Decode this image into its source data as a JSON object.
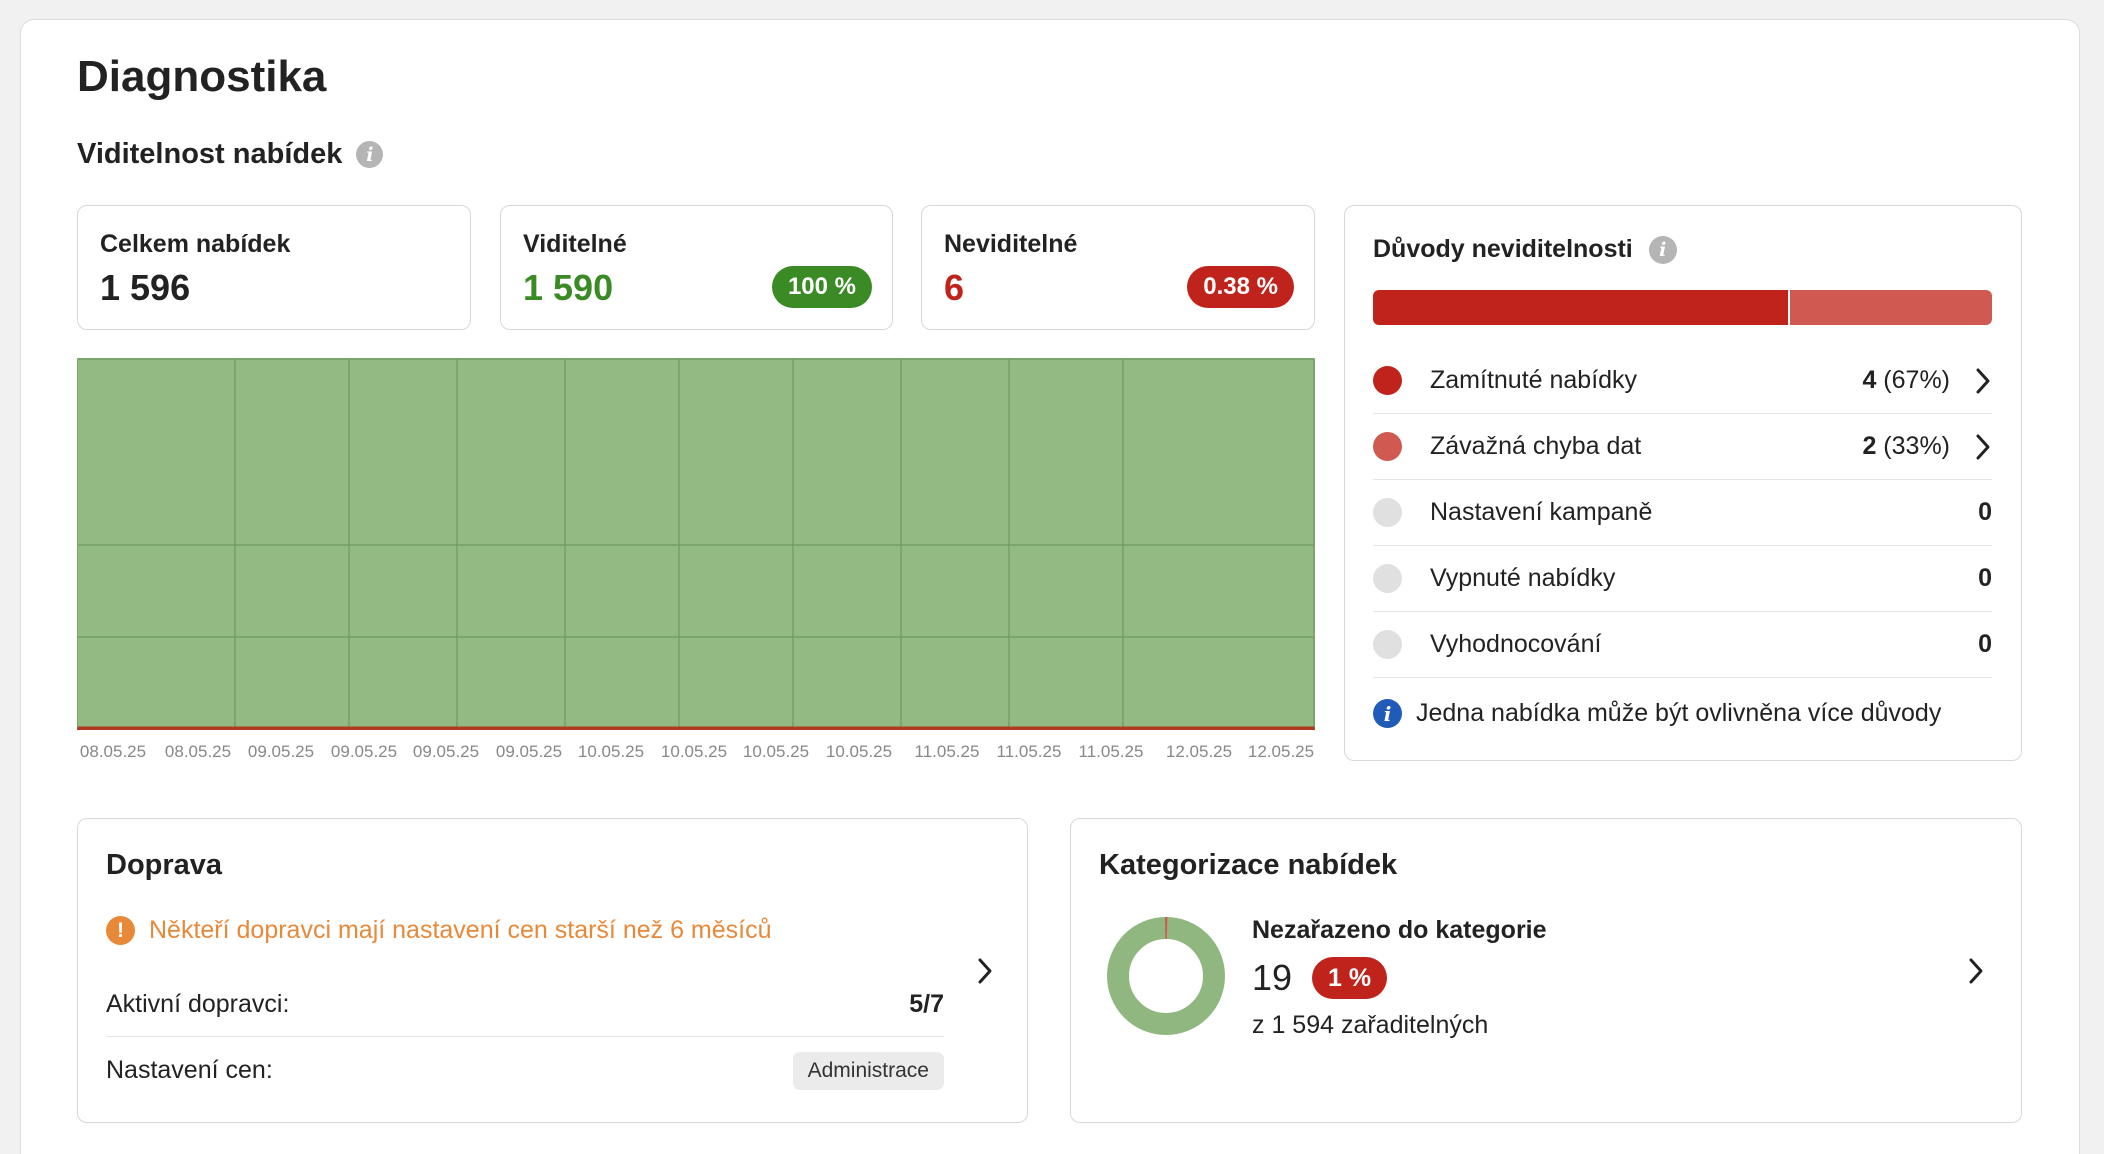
{
  "page": {
    "title": "Diagnostika",
    "section_title": "Viditelnost nabídek",
    "info_glyph": "i"
  },
  "stats": {
    "total": {
      "label": "Celkem nabídek",
      "value": "1 596"
    },
    "visible": {
      "label": "Viditelné",
      "value": "1 590",
      "badge": "100 %"
    },
    "invisible": {
      "label": "Neviditelné",
      "value": "6",
      "badge": "0.38 %"
    }
  },
  "chart_data": {
    "type": "area",
    "x": [
      "08.05.25",
      "08.05.25",
      "09.05.25",
      "09.05.25",
      "09.05.25",
      "09.05.25",
      "10.05.25",
      "10.05.25",
      "10.05.25",
      "10.05.25",
      "11.05.25",
      "11.05.25",
      "11.05.25",
      "12.05.25",
      "12.05.25"
    ],
    "series": [
      {
        "color": "#94ba84",
        "values": [
          1590,
          1590,
          1590,
          1590,
          1590,
          1590,
          1590,
          1590,
          1590,
          1590,
          1590,
          1590,
          1590,
          1590,
          1590
        ]
      },
      {
        "color": "#b03a1f",
        "values": [
          6,
          6,
          6,
          6,
          6,
          6,
          6,
          6,
          6,
          6,
          6,
          6,
          6,
          6,
          6
        ]
      }
    ],
    "stacked": true,
    "grid": true,
    "legend": "none"
  },
  "reasons": {
    "title": "Důvody neviditelnosti",
    "bar": [
      {
        "fraction": 0.67,
        "color": "#c0231c"
      },
      {
        "fraction": 0.33,
        "color": "#d05a51"
      }
    ],
    "items": [
      {
        "label": "Zamítnuté nabídky",
        "count": "4",
        "pct": " (67%)",
        "color": "#c0231c",
        "has_link": true
      },
      {
        "label": "Závažná chyba dat",
        "count": "2",
        "pct": " (33%)",
        "color": "#d05a51",
        "has_link": true
      },
      {
        "label": "Nastavení kampaně",
        "count": "0",
        "pct": "",
        "color": "#e0e0e0",
        "has_link": false
      },
      {
        "label": "Vypnuté nabídky",
        "count": "0",
        "pct": "",
        "color": "#e0e0e0",
        "has_link": false
      },
      {
        "label": "Vyhodnocování",
        "count": "0",
        "pct": "",
        "color": "#e0e0e0",
        "has_link": false
      }
    ],
    "note": "Jedna nabídka může být ovlivněna více důvody"
  },
  "doprava": {
    "title": "Doprava",
    "warning": "Někteří dopravci mají nastavení cen starší než 6 měsíců",
    "warning_glyph": "!",
    "active_label": "Aktivní dopravci:",
    "active_value": "5/7",
    "prices_label": "Nastavení cen:",
    "prices_tag": "Administrace"
  },
  "kategorizace": {
    "title": "Kategorizace nabídek",
    "subtitle": "Nezařazeno do kategorie",
    "value": "19",
    "badge": "1 %",
    "of_text": "z 1 594 zařaditelných",
    "uncategorized_fraction": 0.012,
    "ring_color": "#8fb77f",
    "ring_gap_color": "#d05a51"
  }
}
